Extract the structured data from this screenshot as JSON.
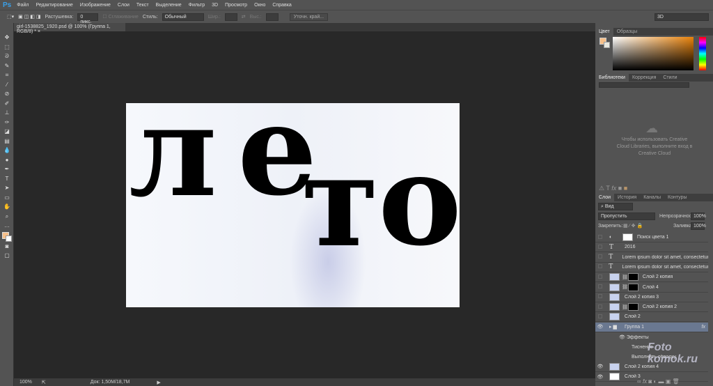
{
  "app": {
    "logo": "Ps",
    "workspace": "3D"
  },
  "menu": [
    "Файл",
    "Редактирование",
    "Изображение",
    "Слои",
    "Текст",
    "Выделение",
    "Фильтр",
    "3D",
    "Просмотр",
    "Окно",
    "Справка"
  ],
  "options": {
    "feather_label": "Растушевка:",
    "feather_value": "0 пикс.",
    "antialias": "Сглаживание",
    "style_label": "Стиль:",
    "style_value": "Обычный",
    "width_label": "Шир.:",
    "height_label": "Выс.:",
    "refine": "Уточн. край..."
  },
  "document": {
    "tab": "girl-1538825_1920.psd @ 100% (Группа 1, RGB/8) *",
    "close": "×",
    "text": [
      "л",
      "е",
      "т",
      "о"
    ]
  },
  "status": {
    "zoom": "100%",
    "doc": "Док: 1,50M/18,7M"
  },
  "color_panel": {
    "tabs": [
      "Цвет",
      "Образцы"
    ],
    "fg": "#f7c08a",
    "hue": "#e8820a"
  },
  "libraries": {
    "tabs": [
      "Библиотеки",
      "Коррекция",
      "Стили"
    ],
    "message": "Чтобы использовать Creative Cloud Libraries, выполните вход в Creative Cloud"
  },
  "layers_panel": {
    "tabs": [
      "Слои",
      "История",
      "Каналы",
      "Контуры"
    ],
    "filter": "Вид",
    "blend": "Пропустить",
    "opacity_label": "Непрозрачность:",
    "opacity": "100%",
    "lock_label": "Закрепить:",
    "fill_label": "Заливка:",
    "fill": "100%",
    "layers": [
      {
        "name": "Поиск цвета 1",
        "type": "adj",
        "visible": false
      },
      {
        "name": "2016",
        "type": "text",
        "visible": false
      },
      {
        "name": "Lorem ipsum dolor sit amet, consectetur adi...",
        "type": "text",
        "visible": false
      },
      {
        "name": "Lorem ipsum dolor sit amet, consectetur adi...",
        "type": "text",
        "visible": false
      },
      {
        "name": "Слой 2 копия",
        "type": "mask",
        "visible": false
      },
      {
        "name": "Слой 4",
        "type": "mask",
        "visible": false
      },
      {
        "name": "Слой 2 копия 3",
        "type": "img",
        "visible": false
      },
      {
        "name": "Слой 2 копия 2",
        "type": "mask",
        "visible": false
      },
      {
        "name": "Слой 2",
        "type": "img",
        "visible": false
      },
      {
        "name": "Группа 1",
        "type": "group",
        "visible": true,
        "fx": "fx"
      },
      {
        "name": "Эффекты",
        "type": "fx",
        "visible": true
      },
      {
        "name": "Тиснение",
        "type": "fxitem"
      },
      {
        "name": "Выполнить обводку",
        "type": "fxitem"
      },
      {
        "name": "Слой 2 копия 4",
        "type": "img",
        "visible": true
      },
      {
        "name": "Слой 3",
        "type": "white",
        "visible": true
      }
    ]
  },
  "watermark": "Foto komok.ru"
}
